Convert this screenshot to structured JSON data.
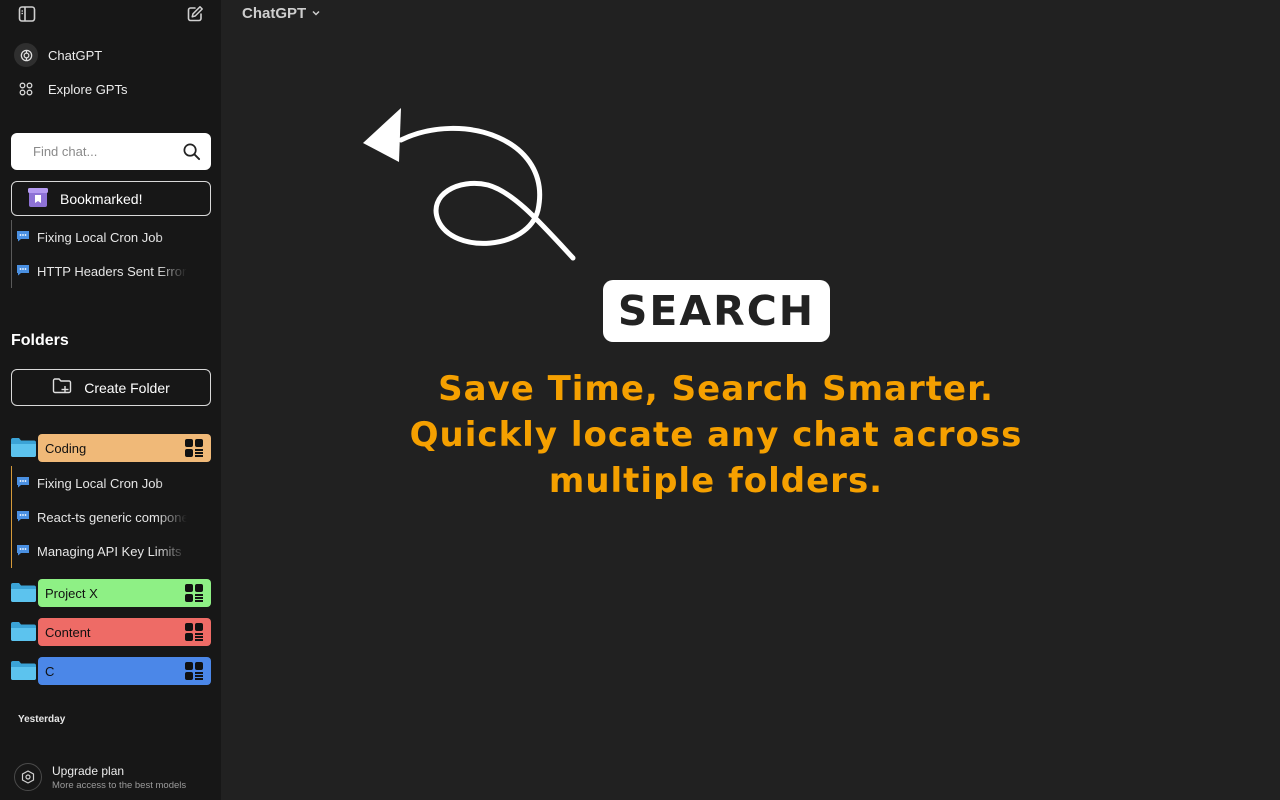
{
  "sidebar": {
    "nav": [
      {
        "label": "ChatGPT",
        "icon": "openai-logo-icon"
      },
      {
        "label": "Explore GPTs",
        "icon": "grid-dots-icon"
      }
    ],
    "search": {
      "placeholder": "Find chat..."
    },
    "bookmark": {
      "label": "Bookmarked!"
    },
    "bookmarked_chats": [
      "Fixing Local Cron Job",
      "HTTP Headers Sent Error"
    ],
    "folders_heading": "Folders",
    "create_folder_label": "Create Folder",
    "folders": [
      {
        "name": "Coding",
        "color": "#f0b978",
        "chats": [
          "Fixing Local Cron Job",
          "React-ts generic components",
          "Managing API Key Limits"
        ]
      },
      {
        "name": "Project X",
        "color": "#8ef085",
        "chats": []
      },
      {
        "name": "Content",
        "color": "#ee6b66",
        "chats": []
      },
      {
        "name": "C",
        "color": "#4b87e8",
        "chats": []
      }
    ],
    "section_label": "Yesterday",
    "upgrade": {
      "title": "Upgrade plan",
      "subtitle": "More access to the best models"
    }
  },
  "header": {
    "model_label": "ChatGPT"
  },
  "promo": {
    "badge": "SEARCH",
    "headline_lines": [
      "Save Time, Search Smarter.",
      "Quickly locate any chat across",
      "multiple folders."
    ],
    "accent_color": "#f5a000"
  }
}
